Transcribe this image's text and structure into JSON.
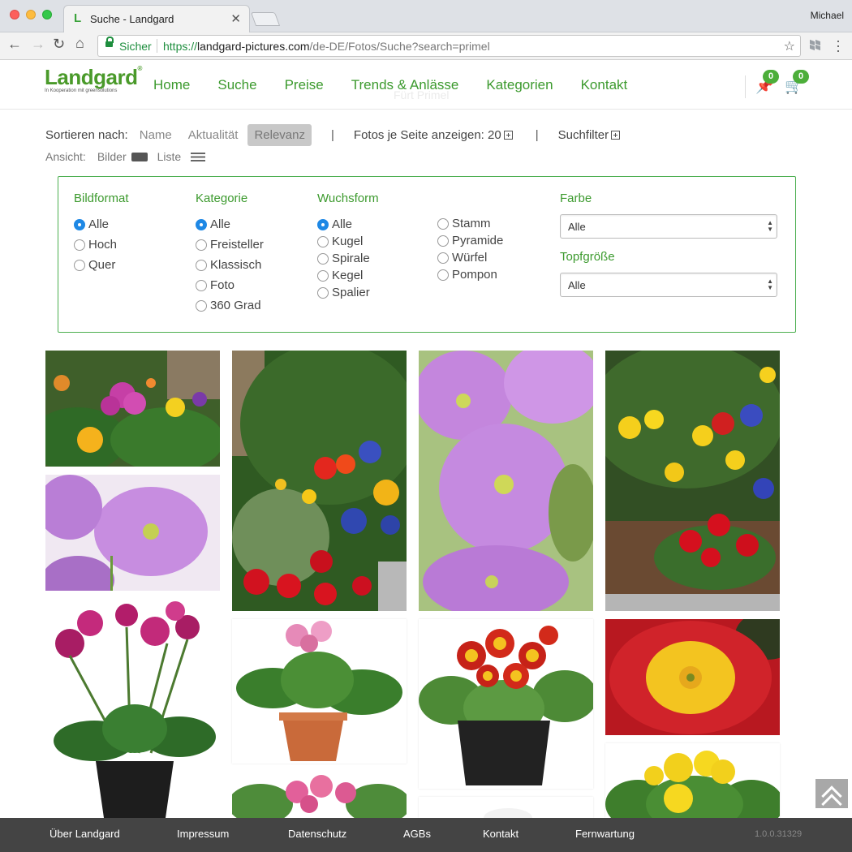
{
  "browser": {
    "tab_title": "Suche - Landgard",
    "tab_favicon": "L",
    "profile_name": "Michael",
    "secure_label": "Sicher",
    "url_scheme": "https://",
    "url_host": "landgard-pictures.com",
    "url_path": "/de-DE/Fotos/Suche?search=primel"
  },
  "header": {
    "logo_text": "Landgard",
    "logo_tagline": "In Kooperation mit greensolutions",
    "nav": [
      "Home",
      "Suche",
      "Preise",
      "Trends & Anlässe",
      "Kategorien",
      "Kontakt"
    ],
    "ghost_search": "Fürt Primel",
    "pin_count": "0",
    "cart_count": "0"
  },
  "sort": {
    "label": "Sortieren nach:",
    "options": [
      "Name",
      "Aktualität",
      "Relevanz"
    ],
    "active": "Relevanz",
    "per_page_label": "Fotos je Seite anzeigen: 20",
    "filter_label": "Suchfilter"
  },
  "view": {
    "label": "Ansicht:",
    "images": "Bilder",
    "list": "Liste"
  },
  "filters": {
    "bildformat": {
      "title": "Bildformat",
      "options": [
        "Alle",
        "Hoch",
        "Quer"
      ],
      "selected": "Alle"
    },
    "kategorie": {
      "title": "Kategorie",
      "options": [
        "Alle",
        "Freisteller",
        "Klassisch",
        "Foto",
        "360 Grad"
      ],
      "selected": "Alle"
    },
    "wuchsform": {
      "title": "Wuchsform",
      "col1": [
        "Alle",
        "Kugel",
        "Spirale",
        "Kegel",
        "Spalier"
      ],
      "col2": [
        "Stamm",
        "Pyramide",
        "Würfel",
        "Pompon"
      ],
      "selected": "Alle"
    },
    "farbe": {
      "title": "Farbe",
      "value": "Alle"
    },
    "topfgroesse": {
      "title": "Topfgröße",
      "value": "Alle"
    }
  },
  "colors": {
    "brand_green": "#3c9a2e",
    "badge_green": "#4cae3a",
    "radio_blue": "#1e88e5",
    "footer_bg": "#444444"
  },
  "footer": {
    "links": [
      "Über Landgard",
      "Impressum",
      "Datenschutz",
      "AGBs",
      "Kontakt",
      "Fernwartung"
    ],
    "version": "1.0.0.31329"
  }
}
